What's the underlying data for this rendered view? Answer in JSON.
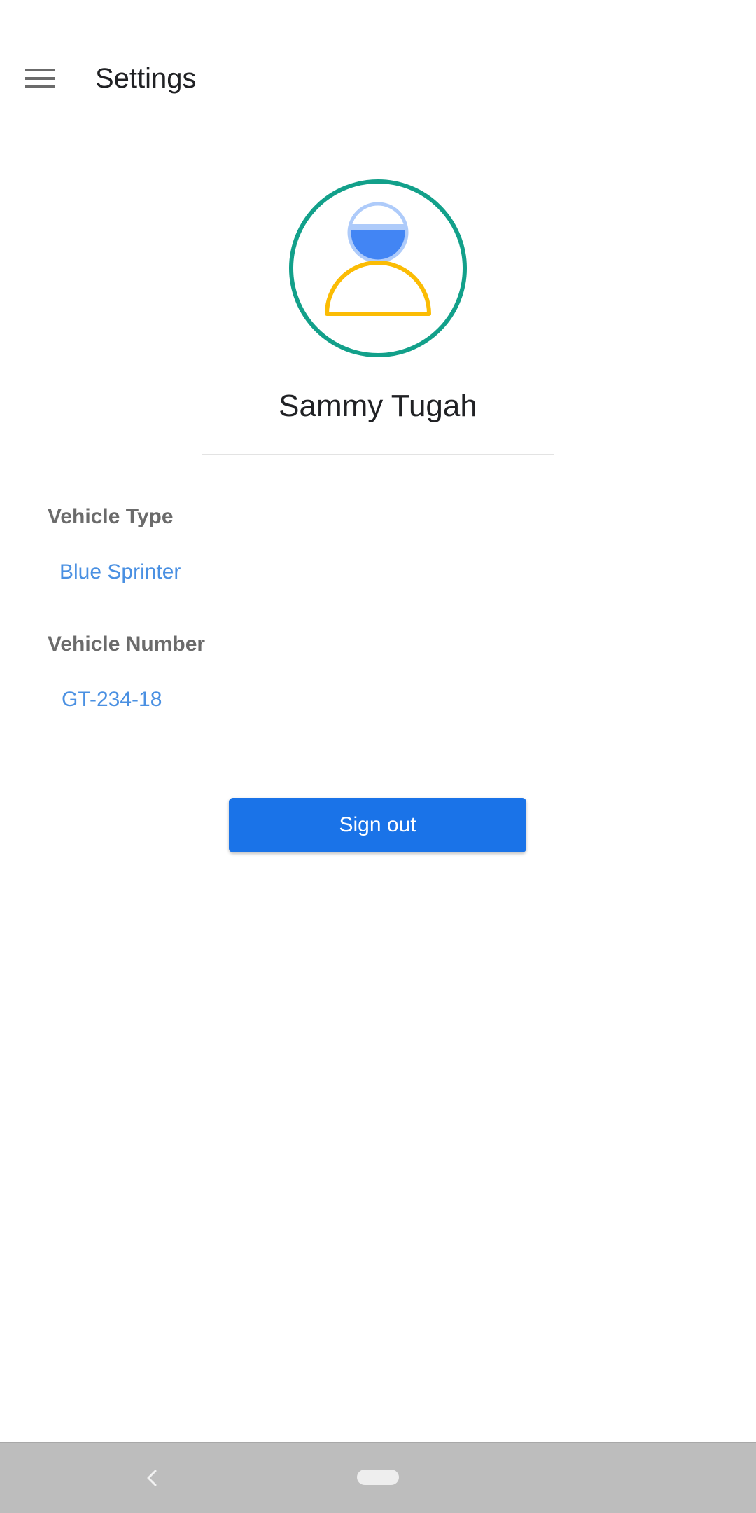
{
  "app_bar": {
    "title": "Settings",
    "menu_icon": "hamburger-menu-icon"
  },
  "profile": {
    "avatar_icon": "driver-avatar-icon",
    "name": "Sammy Tugah"
  },
  "fields": {
    "vehicle_type_label": "Vehicle Type",
    "vehicle_type_value": "Blue Sprinter",
    "vehicle_number_label": "Vehicle Number",
    "vehicle_number_value": "GT-234-18"
  },
  "actions": {
    "sign_out_label": "Sign out"
  },
  "nav_bar": {
    "back_icon": "back-chevron-icon",
    "home_icon": "home-pill-icon"
  },
  "colors": {
    "accent": "#1a73e8",
    "link": "#4a90e2",
    "avatar_ring": "#12a08a",
    "avatar_head_light": "#aecbfa",
    "avatar_head_dark": "#4285f4",
    "avatar_body": "#fbbc04",
    "nav_bar_bg": "#bdbdbd"
  }
}
